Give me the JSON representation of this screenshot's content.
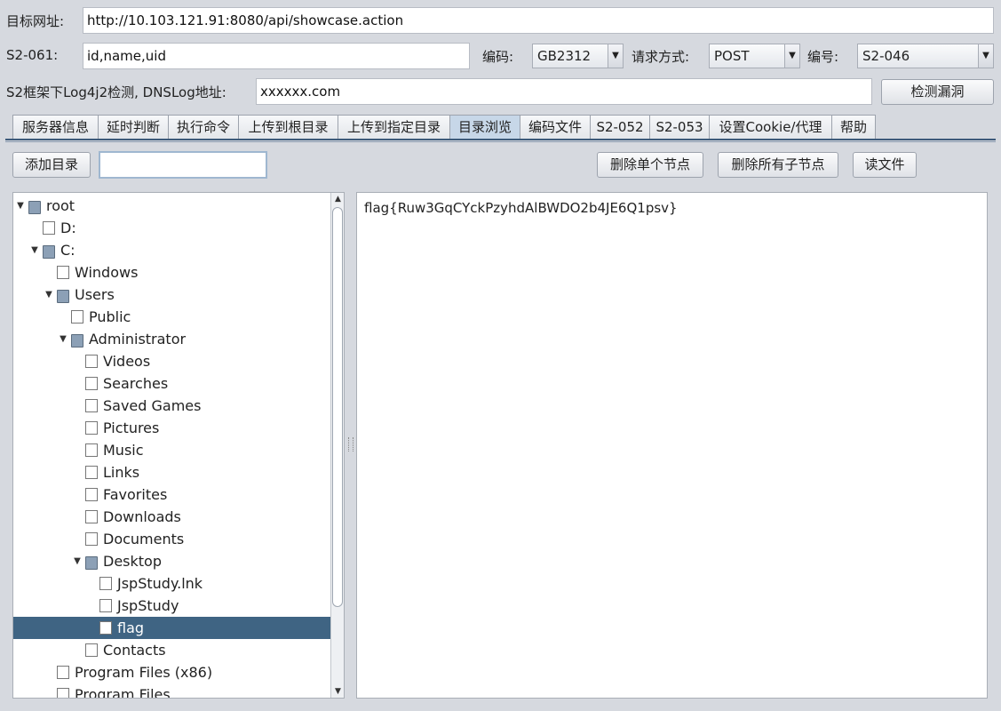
{
  "form": {
    "target_label": "目标网址:",
    "target_value": "http://10.103.121.91:8080/api/showcase.action",
    "s2061_label": "S2-061:",
    "s2061_value": "id,name,uid",
    "encoding_label": "编码:",
    "encoding_value": "GB2312",
    "method_label": "请求方式:",
    "method_value": "POST",
    "number_label": "编号:",
    "number_value": "S2-046",
    "log4j_label": "S2框架下Log4j2检测, DNSLog地址:",
    "log4j_value": "xxxxxx.com",
    "detect_button": "检测漏洞"
  },
  "tabs": [
    {
      "label": "服务器信息"
    },
    {
      "label": "延时判断"
    },
    {
      "label": "执行命令"
    },
    {
      "label": "上传到根目录"
    },
    {
      "label": "上传到指定目录"
    },
    {
      "label": "目录浏览",
      "active": true
    },
    {
      "label": "编码文件"
    },
    {
      "label": "S2-052"
    },
    {
      "label": "S2-053"
    },
    {
      "label": "设置Cookie/代理"
    },
    {
      "label": "帮助"
    }
  ],
  "toolbar": {
    "add_dir_button": "添加目录",
    "dir_input_value": "",
    "delete_node_button": "删除单个节点",
    "delete_children_button": "删除所有子节点",
    "read_file_button": "读文件"
  },
  "tree": [
    {
      "label": "root",
      "depth": 0,
      "folder": true,
      "expanded": true
    },
    {
      "label": "D:",
      "depth": 1,
      "folder": false
    },
    {
      "label": "C:",
      "depth": 1,
      "folder": true,
      "expanded": true
    },
    {
      "label": "Windows",
      "depth": 2,
      "folder": false
    },
    {
      "label": "Users",
      "depth": 2,
      "folder": true,
      "expanded": true
    },
    {
      "label": "Public",
      "depth": 3,
      "folder": false
    },
    {
      "label": "Administrator",
      "depth": 3,
      "folder": true,
      "expanded": true
    },
    {
      "label": "Videos",
      "depth": 4,
      "folder": false
    },
    {
      "label": "Searches",
      "depth": 4,
      "folder": false
    },
    {
      "label": "Saved Games",
      "depth": 4,
      "folder": false
    },
    {
      "label": "Pictures",
      "depth": 4,
      "folder": false
    },
    {
      "label": "Music",
      "depth": 4,
      "folder": false
    },
    {
      "label": "Links",
      "depth": 4,
      "folder": false
    },
    {
      "label": "Favorites",
      "depth": 4,
      "folder": false
    },
    {
      "label": "Downloads",
      "depth": 4,
      "folder": false
    },
    {
      "label": "Documents",
      "depth": 4,
      "folder": false
    },
    {
      "label": "Desktop",
      "depth": 4,
      "folder": true,
      "expanded": true
    },
    {
      "label": "JspStudy.lnk",
      "depth": 5,
      "folder": false
    },
    {
      "label": "JspStudy",
      "depth": 5,
      "folder": false
    },
    {
      "label": "flag",
      "depth": 5,
      "folder": false,
      "selected": true
    },
    {
      "label": "Contacts",
      "depth": 4,
      "folder": false
    },
    {
      "label": "Program Files (x86)",
      "depth": 2,
      "folder": false
    },
    {
      "label": "Program Files",
      "depth": 2,
      "folder": false
    }
  ],
  "file_content": "flag{Ruw3GqCYckPzyhdAlBWDO2b4JE6Q1psv}",
  "colors": {
    "selection": "#3f6483",
    "active_tab": "#c7d7e8",
    "background": "#d6d9df"
  }
}
